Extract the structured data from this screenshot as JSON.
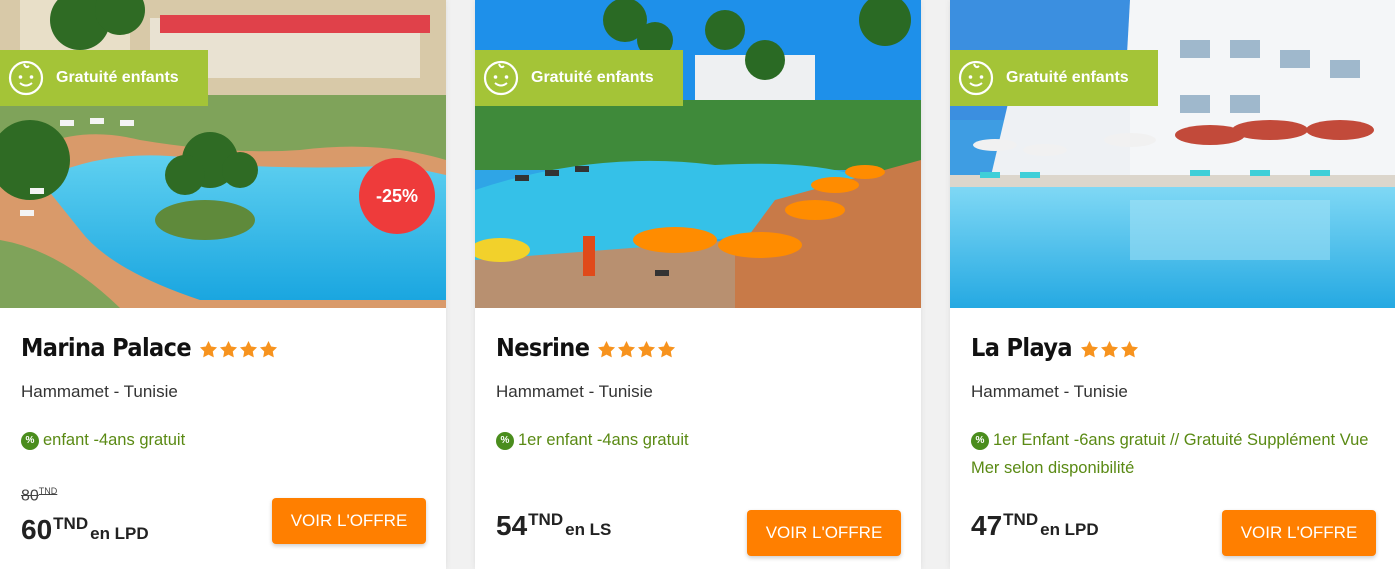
{
  "colors": {
    "badge_green": "#a4c437",
    "discount_red": "#ee3b3b",
    "cta_orange": "#ff7f00",
    "star_orange": "#f7931e",
    "offer_green": "#5a8a14"
  },
  "cards": [
    {
      "badge": "Gratuité enfants",
      "discount": "-25%",
      "name": "Marina Palace",
      "stars": 4,
      "location": "Hammamet - Tunisie",
      "offer_icon": "%",
      "offer": "enfant -4ans gratuit",
      "old_price": "80",
      "old_currency": "TND",
      "price": "60",
      "currency": "TND",
      "board": "en LPD",
      "cta": "VOIR L'OFFRE",
      "image_icon": "hotel-pool-photo"
    },
    {
      "badge": "Gratuité enfants",
      "name": "Nesrine",
      "stars": 4,
      "location": "Hammamet - Tunisie",
      "offer_icon": "%",
      "offer": "1er enfant -4ans gratuit",
      "price": "54",
      "currency": "TND",
      "board": "en LS",
      "cta": "VOIR L'OFFRE",
      "image_icon": "hotel-pool-photo"
    },
    {
      "badge": "Gratuité enfants",
      "name": "La Playa",
      "stars": 3,
      "location": "Hammamet - Tunisie",
      "offer_icon": "%",
      "offer": "1er Enfant -6ans gratuit // Gratuité Supplément Vue Mer selon disponibilité",
      "price": "47",
      "currency": "TND",
      "board": "en LPD",
      "cta": "VOIR L'OFFRE",
      "image_icon": "hotel-pool-photo"
    }
  ]
}
